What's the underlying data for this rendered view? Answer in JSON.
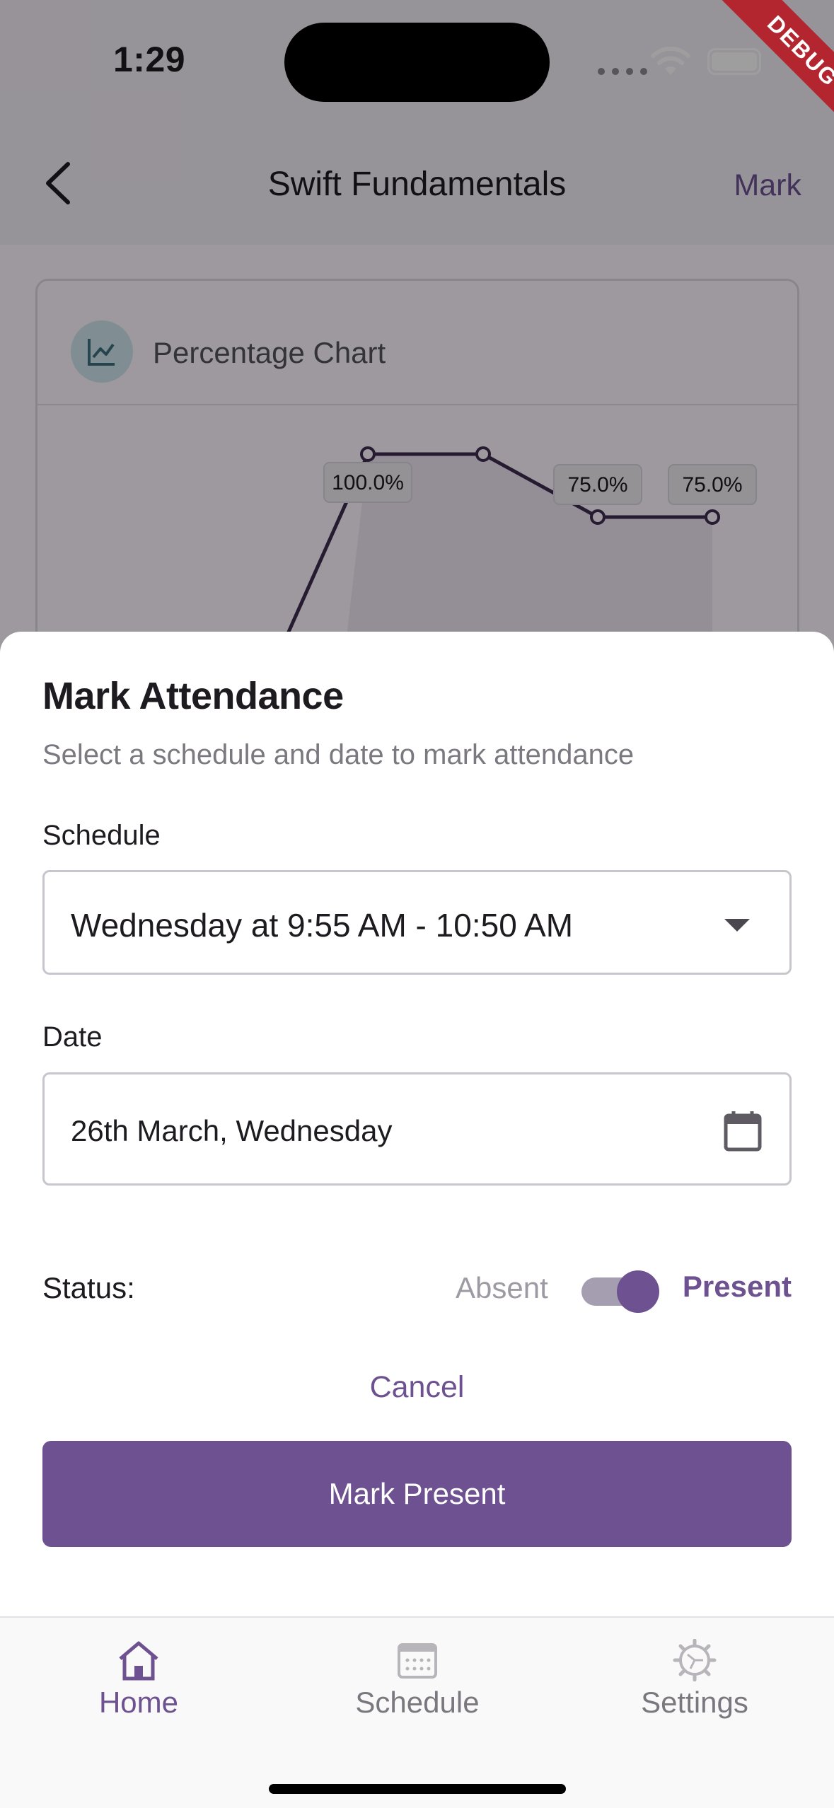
{
  "status_bar": {
    "time": "1:29",
    "debug_banner": "DEBUG"
  },
  "app_bar": {
    "title": "Swift Fundamentals",
    "action_label": "Mark"
  },
  "chart_card": {
    "title": "Percentage Chart"
  },
  "chart_data": {
    "type": "line",
    "data_labels": [
      "100.0%",
      "75.0%",
      "75.0%"
    ],
    "values": [
      100,
      100,
      75,
      75
    ],
    "color": "#3f2d52"
  },
  "sheet": {
    "title": "Mark Attendance",
    "subtitle": "Select a schedule and date to mark attendance",
    "schedule_label": "Schedule",
    "schedule_value": "Wednesday at 9:55 AM - 10:50 AM",
    "date_label": "Date",
    "date_value": "26th March, Wednesday",
    "status_label": "Status:",
    "absent_label": "Absent",
    "present_label": "Present",
    "status_present": true,
    "cancel_label": "Cancel",
    "submit_label": "Mark Present"
  },
  "bottom_nav": {
    "items": [
      {
        "label": "Home",
        "icon": "home-icon",
        "active": true
      },
      {
        "label": "Schedule",
        "icon": "calendar-icon",
        "active": false
      },
      {
        "label": "Settings",
        "icon": "gear-icon",
        "active": false
      }
    ]
  },
  "colors": {
    "primary": "#6d5190",
    "active_nav": "#6d5190",
    "inactive_nav": "#7a777e"
  }
}
